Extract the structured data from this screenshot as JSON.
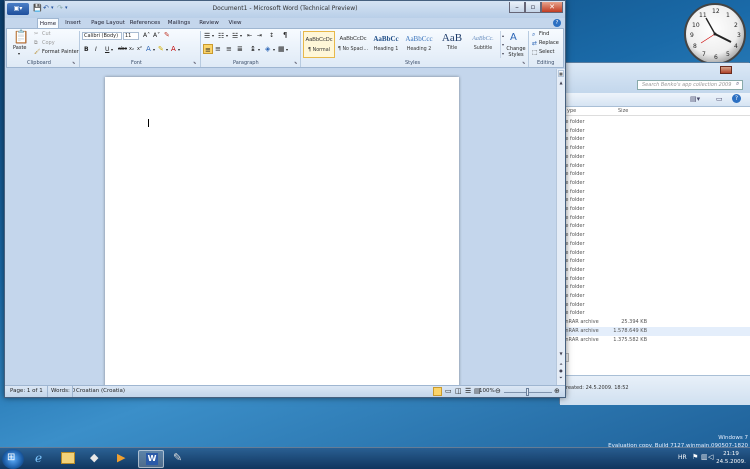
{
  "clock": {
    "numerals": [
      "12",
      "1",
      "2",
      "3",
      "4",
      "5",
      "6",
      "7",
      "8",
      "9",
      "10",
      "11"
    ]
  },
  "explorer": {
    "search_placeholder": "Search Benko's app collection 2009",
    "col_type": "ype",
    "col_size": "Size",
    "rows": [
      {
        "type": "le folder",
        "size": ""
      },
      {
        "type": "le folder",
        "size": ""
      },
      {
        "type": "le folder",
        "size": ""
      },
      {
        "type": "le folder",
        "size": ""
      },
      {
        "type": "le folder",
        "size": ""
      },
      {
        "type": "le folder",
        "size": ""
      },
      {
        "type": "le folder",
        "size": ""
      },
      {
        "type": "le folder",
        "size": ""
      },
      {
        "type": "le folder",
        "size": ""
      },
      {
        "type": "le folder",
        "size": ""
      },
      {
        "type": "le folder",
        "size": ""
      },
      {
        "type": "le folder",
        "size": ""
      },
      {
        "type": "le folder",
        "size": ""
      },
      {
        "type": "le folder",
        "size": ""
      },
      {
        "type": "le folder",
        "size": ""
      },
      {
        "type": "le folder",
        "size": ""
      },
      {
        "type": "le folder",
        "size": ""
      },
      {
        "type": "le folder",
        "size": ""
      },
      {
        "type": "le folder",
        "size": ""
      },
      {
        "type": "le folder",
        "size": ""
      },
      {
        "type": "le folder",
        "size": ""
      },
      {
        "type": "le folder",
        "size": ""
      },
      {
        "type": "le folder",
        "size": ""
      },
      {
        "type": "inRAR archive",
        "size": "25.394 KB"
      },
      {
        "type": "inRAR archive",
        "size": "1.578.649 KB"
      },
      {
        "type": "inRAR archive",
        "size": "1.375.582 KB"
      }
    ],
    "status": "reated: 24.5.2009. 18:52"
  },
  "word": {
    "title": "Document1 - Microsoft Word (Technical Preview)",
    "tabs": [
      "Home",
      "Insert",
      "Page Layout",
      "References",
      "Mailings",
      "Review",
      "View"
    ],
    "clipboard": {
      "paste": "Paste",
      "cut": "Cut",
      "copy": "Copy",
      "format_painter": "Format Painter",
      "group": "Clipboard"
    },
    "font": {
      "name": "Calibri (Body)",
      "size": "11",
      "group": "Font",
      "bold": "B",
      "italic": "I",
      "underline": "U"
    },
    "paragraph": {
      "group": "Paragraph",
      "pilcrow": "¶"
    },
    "styles": {
      "group": "Styles",
      "items": [
        {
          "preview": "AaBbCcDc",
          "name": "¶ Normal"
        },
        {
          "preview": "AaBbCcDc",
          "name": "¶ No Spaci..."
        },
        {
          "preview": "AaBbCc",
          "name": "Heading 1"
        },
        {
          "preview": "AaBbCcc",
          "name": "Heading 2"
        },
        {
          "preview": "AaB",
          "name": "Title"
        },
        {
          "preview": "AaBbCc.",
          "name": "Subtitle"
        }
      ],
      "change_styles": "Change Styles"
    },
    "editing": {
      "group": "Editing",
      "find": "Find",
      "replace": "Replace",
      "select": "Select"
    },
    "status": {
      "page": "Page: 1 of 1",
      "words": "Words: 0",
      "language": "Croatian (Croatia)",
      "zoom": "100%"
    }
  },
  "taskbar": {
    "lang": "HR",
    "time": "21:19",
    "date": "24.5.2009."
  },
  "watermark": {
    "line1": "Windows 7",
    "line2": "Evaluation copy. Build 7127.winmain.090507-1820"
  }
}
